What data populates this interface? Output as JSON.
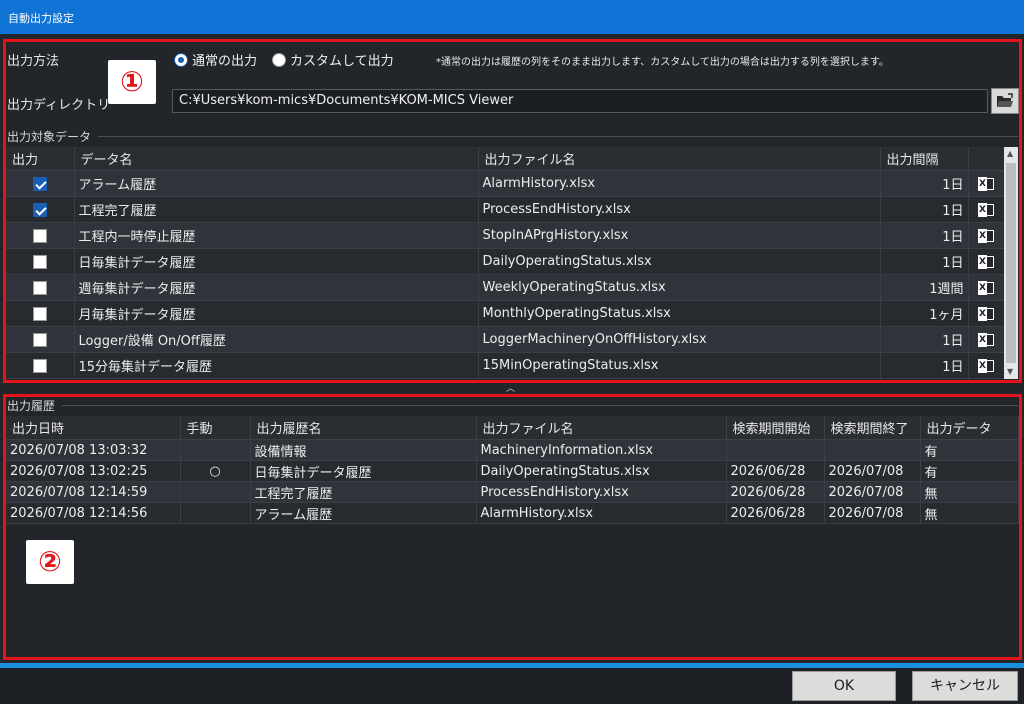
{
  "window": {
    "title": "自動出力設定"
  },
  "section1": {
    "badge": "①",
    "method_label": "出力方法",
    "radio_normal": "通常の出力",
    "radio_custom": "カスタムして出力",
    "selected_method": "normal",
    "note": "*通常の出力は履歴の列をそのまま出力します、カスタムして出力の場合は出力する列を選択します。",
    "dir_label": "出力ディレクトリ",
    "dir_value": "C:¥Users¥kom-mics¥Documents¥KOM-MICS Viewer",
    "group_label": "出力対象データ",
    "columns": {
      "output": "出力",
      "name": "データ名",
      "file": "出力ファイル名",
      "interval": "出力間隔"
    },
    "rows": [
      {
        "checked": true,
        "name": "アラーム履歴",
        "file": "AlarmHistory.xlsx",
        "interval": "1日"
      },
      {
        "checked": true,
        "name": "工程完了履歴",
        "file": "ProcessEndHistory.xlsx",
        "interval": "1日"
      },
      {
        "checked": false,
        "name": "工程内一時停止履歴",
        "file": "StopInAPrgHistory.xlsx",
        "interval": "1日"
      },
      {
        "checked": false,
        "name": "日毎集計データ履歴",
        "file": "DailyOperatingStatus.xlsx",
        "interval": "1日"
      },
      {
        "checked": false,
        "name": "週毎集計データ履歴",
        "file": "WeeklyOperatingStatus.xlsx",
        "interval": "1週間"
      },
      {
        "checked": false,
        "name": "月毎集計データ履歴",
        "file": "MonthlyOperatingStatus.xlsx",
        "interval": "1ヶ月"
      },
      {
        "checked": false,
        "name": "Logger/設備 On/Off履歴",
        "file": "LoggerMachineryOnOffHistory.xlsx",
        "interval": "1日"
      },
      {
        "checked": false,
        "name": "15分毎集計データ履歴",
        "file": "15MinOperatingStatus.xlsx",
        "interval": "1日"
      }
    ]
  },
  "section2": {
    "badge": "②",
    "group_label": "出力履歴",
    "columns": {
      "datetime": "出力日時",
      "manual": "手動",
      "hist_name": "出力履歴名",
      "file": "出力ファイル名",
      "start": "検索期間開始",
      "end": "検索期間終了",
      "data": "出力データ"
    },
    "rows": [
      {
        "datetime": "2026/07/08 13:03:32",
        "manual": "",
        "hist_name": "設備情報",
        "file": "MachineryInformation.xlsx",
        "start": "",
        "end": "",
        "data": "有"
      },
      {
        "datetime": "2026/07/08 13:02:25",
        "manual": "○",
        "hist_name": "日毎集計データ履歴",
        "file": "DailyOperatingStatus.xlsx",
        "start": "2026/06/28",
        "end": "2026/07/08",
        "data": "有"
      },
      {
        "datetime": "2026/07/08 12:14:59",
        "manual": "",
        "hist_name": "工程完了履歴",
        "file": "ProcessEndHistory.xlsx",
        "start": "2026/06/28",
        "end": "2026/07/08",
        "data": "無"
      },
      {
        "datetime": "2026/07/08 12:14:56",
        "manual": "",
        "hist_name": "アラーム履歴",
        "file": "AlarmHistory.xlsx",
        "start": "2026/06/28",
        "end": "2026/07/08",
        "data": "無"
      }
    ]
  },
  "footer": {
    "ok": "OK",
    "cancel": "キャンセル"
  },
  "colors": {
    "accent": "#0f74d6",
    "highlight": "#e3151b",
    "divider": "#1a8fe0"
  },
  "icons": {
    "folder": "folder-open-icon",
    "excel": "excel-icon",
    "scroll_up": "chevron-up-icon",
    "scroll_down": "chevron-down-icon"
  }
}
